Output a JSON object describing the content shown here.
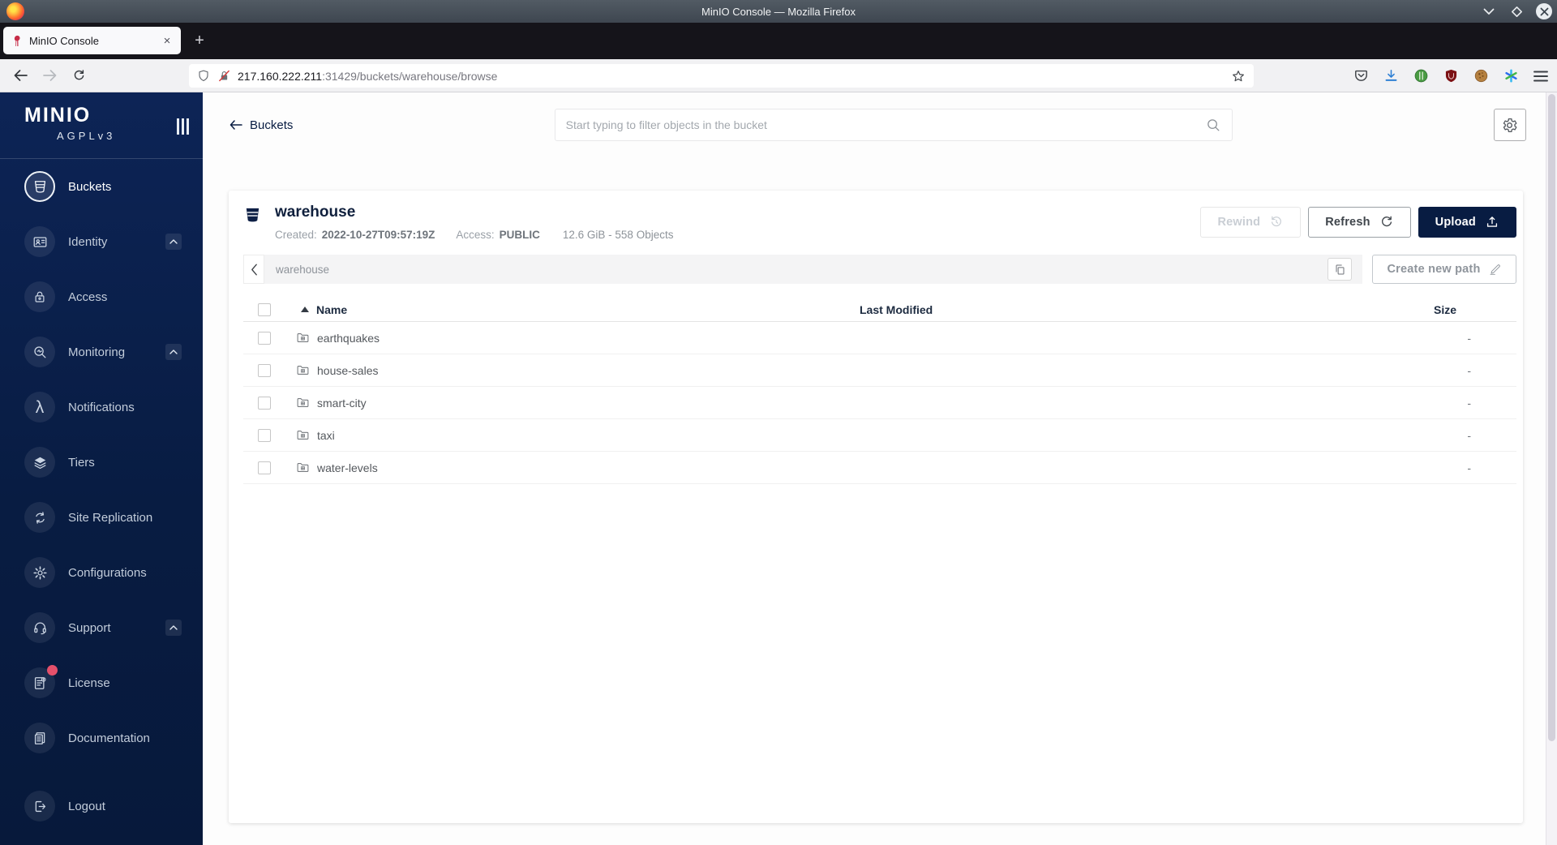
{
  "browser": {
    "window_title": "MinIO Console — Mozilla Firefox",
    "tab_title": "MinIO Console",
    "url_host": "217.160.222.211",
    "url_path": ":31429/buckets/warehouse/browse"
  },
  "icons": {
    "lambda": "λ",
    "new_tab": "+",
    "tab_close": "×"
  },
  "sidebar": {
    "logo": "MINIO",
    "license_tag": "AGPLv3",
    "items": [
      {
        "label": "Buckets",
        "icon": "bucket-icon",
        "selected": true
      },
      {
        "label": "Identity",
        "icon": "identity-card-icon",
        "chevron": "up"
      },
      {
        "label": "Access",
        "icon": "lock-icon"
      },
      {
        "label": "Monitoring",
        "icon": "monitoring-magnifier-icon",
        "chevron": "up"
      },
      {
        "label": "Notifications",
        "icon": "lambda-icon"
      },
      {
        "label": "Tiers",
        "icon": "layers-icon"
      },
      {
        "label": "Site Replication",
        "icon": "replication-arrows-icon"
      },
      {
        "label": "Configurations",
        "icon": "gear-icon"
      },
      {
        "label": "Support",
        "icon": "headset-icon",
        "chevron": "up"
      },
      {
        "label": "License",
        "icon": "license-document-icon",
        "badge_dot": true
      },
      {
        "label": "Documentation",
        "icon": "documentation-pages-icon"
      },
      {
        "label": "Logout",
        "icon": "logout-door-icon"
      }
    ]
  },
  "header": {
    "back_label": "Buckets",
    "search_placeholder": "Start typing to filter objects in the bucket"
  },
  "bucket": {
    "name": "warehouse",
    "created_label": "Created:",
    "created_value": "2022-10-27T09:57:19Z",
    "access_label": "Access:",
    "access_value": "PUBLIC",
    "usage": "12.6 GiB - 558 Objects",
    "buttons": {
      "rewind": "Rewind",
      "refresh": "Refresh",
      "upload": "Upload"
    }
  },
  "browse": {
    "current_path": "warehouse",
    "create_path_label": "Create new path",
    "table": {
      "headers": {
        "name": "Name",
        "last_modified": "Last Modified",
        "size": "Size"
      },
      "rows": [
        {
          "name": "earthquakes",
          "size": "-"
        },
        {
          "name": "house-sales",
          "size": "-"
        },
        {
          "name": "smart-city",
          "size": "-"
        },
        {
          "name": "taxi",
          "size": "-"
        },
        {
          "name": "water-levels",
          "size": "-"
        }
      ]
    }
  },
  "colors": {
    "sidebar_navy": "#081C42",
    "accent_navy": "#081C42",
    "license_badge_red": "#E4506B",
    "download_icon_blue": "#2F80D4"
  }
}
